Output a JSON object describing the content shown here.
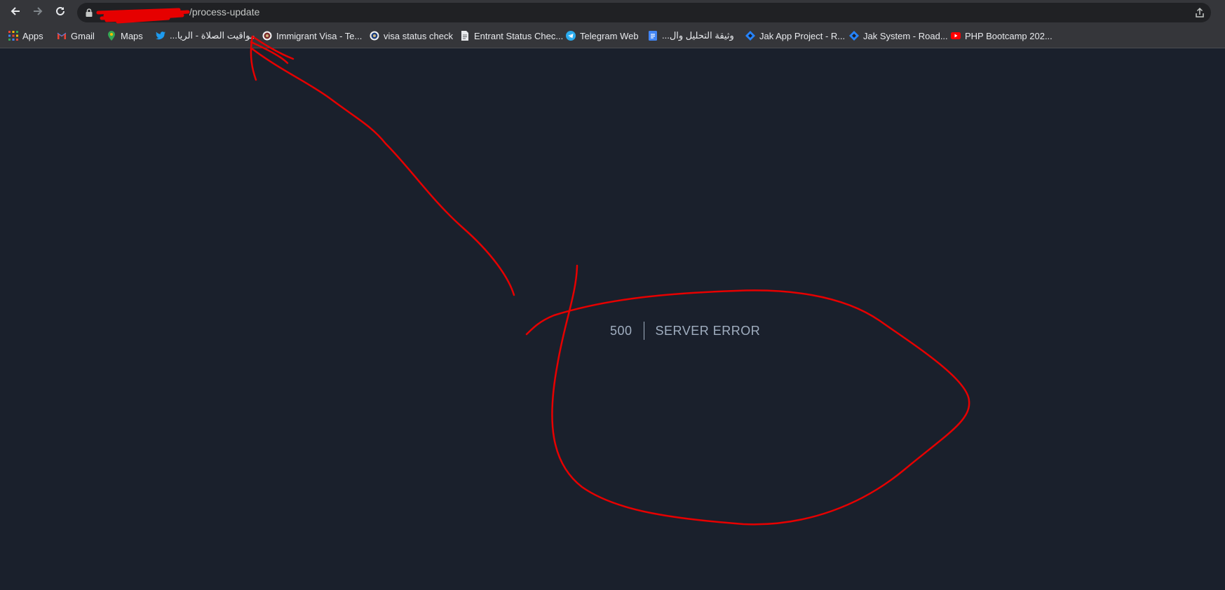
{
  "browser": {
    "url_host": "",
    "url_path": "/process-update",
    "bookmarks": [
      {
        "label": "Apps",
        "icon": "apps-grid-icon"
      },
      {
        "label": "Gmail",
        "icon": "gmail-icon"
      },
      {
        "label": "Maps",
        "icon": "maps-icon"
      },
      {
        "label": "...مواقيت الصلاة - الريا",
        "icon": "twitter-icon"
      },
      {
        "label": "Immigrant Visa - Te...",
        "icon": "seal-icon"
      },
      {
        "label": "visa status check",
        "icon": "seal-icon"
      },
      {
        "label": "Entrant Status Chec...",
        "icon": "document-icon"
      },
      {
        "label": "Telegram Web",
        "icon": "telegram-icon"
      },
      {
        "label": "...وثيقة التحليل وال",
        "icon": "google-docs-icon"
      },
      {
        "label": "Jak App Project - R...",
        "icon": "jira-icon"
      },
      {
        "label": "Jak System - Road...",
        "icon": "jira-icon"
      },
      {
        "label": "PHP Bootcamp 202...",
        "icon": "youtube-icon"
      }
    ]
  },
  "error": {
    "code": "500",
    "message": "SERVER ERROR"
  },
  "colors": {
    "page_bg": "#1a202c",
    "error_text": "#a0aec0",
    "annotation": "#e60000"
  }
}
